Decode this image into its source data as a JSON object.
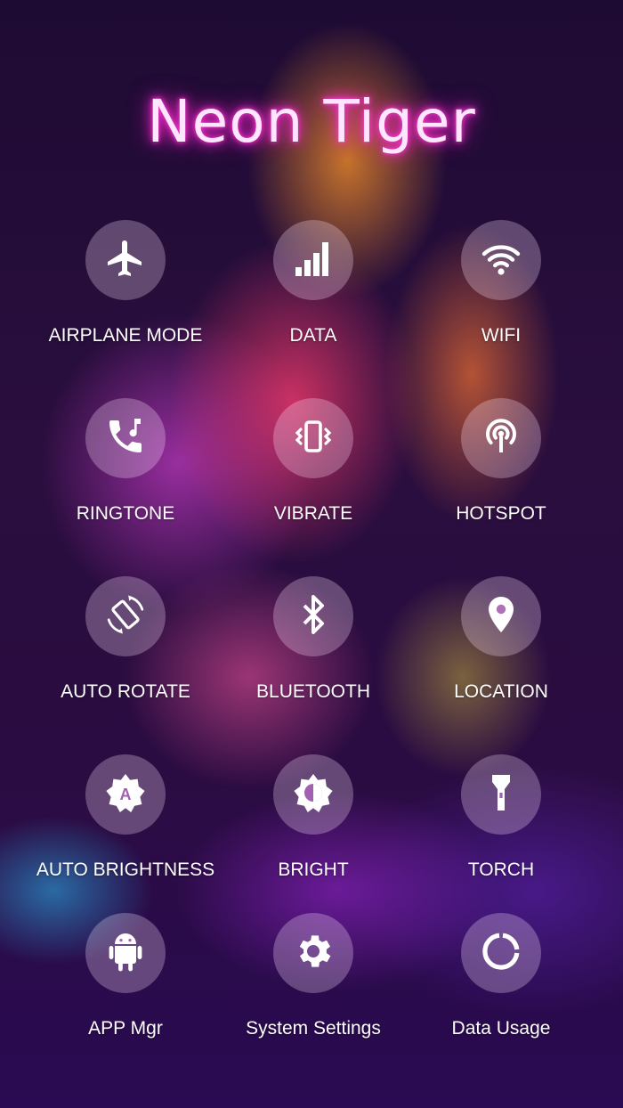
{
  "title": "Neon Tiger",
  "toggles": [
    {
      "label": "AIRPLANE MODE",
      "icon": "airplane-icon"
    },
    {
      "label": "DATA",
      "icon": "signal-bars-icon"
    },
    {
      "label": "WIFI",
      "icon": "wifi-icon"
    },
    {
      "label": "RINGTONE",
      "icon": "ringtone-icon"
    },
    {
      "label": "VIBRATE",
      "icon": "vibrate-icon"
    },
    {
      "label": "HOTSPOT",
      "icon": "hotspot-icon"
    },
    {
      "label": "AUTO ROTATE",
      "icon": "auto-rotate-icon"
    },
    {
      "label": "BLUETOOTH",
      "icon": "bluetooth-icon"
    },
    {
      "label": "LOCATION",
      "icon": "location-pin-icon"
    },
    {
      "label": "AUTO BRIGHTNESS",
      "icon": "auto-brightness-icon"
    },
    {
      "label": "BRIGHT",
      "icon": "brightness-icon"
    },
    {
      "label": "TORCH",
      "icon": "torch-icon"
    },
    {
      "label": "APP Mgr",
      "icon": "android-icon"
    },
    {
      "label": "System Settings",
      "icon": "gear-icon"
    },
    {
      "label": "Data Usage",
      "icon": "data-usage-icon"
    }
  ],
  "colors": {
    "title_glow": "#ff2bd0",
    "circle_fill": "rgba(255,230,255,0.28)",
    "label_text": "#ffffff"
  }
}
